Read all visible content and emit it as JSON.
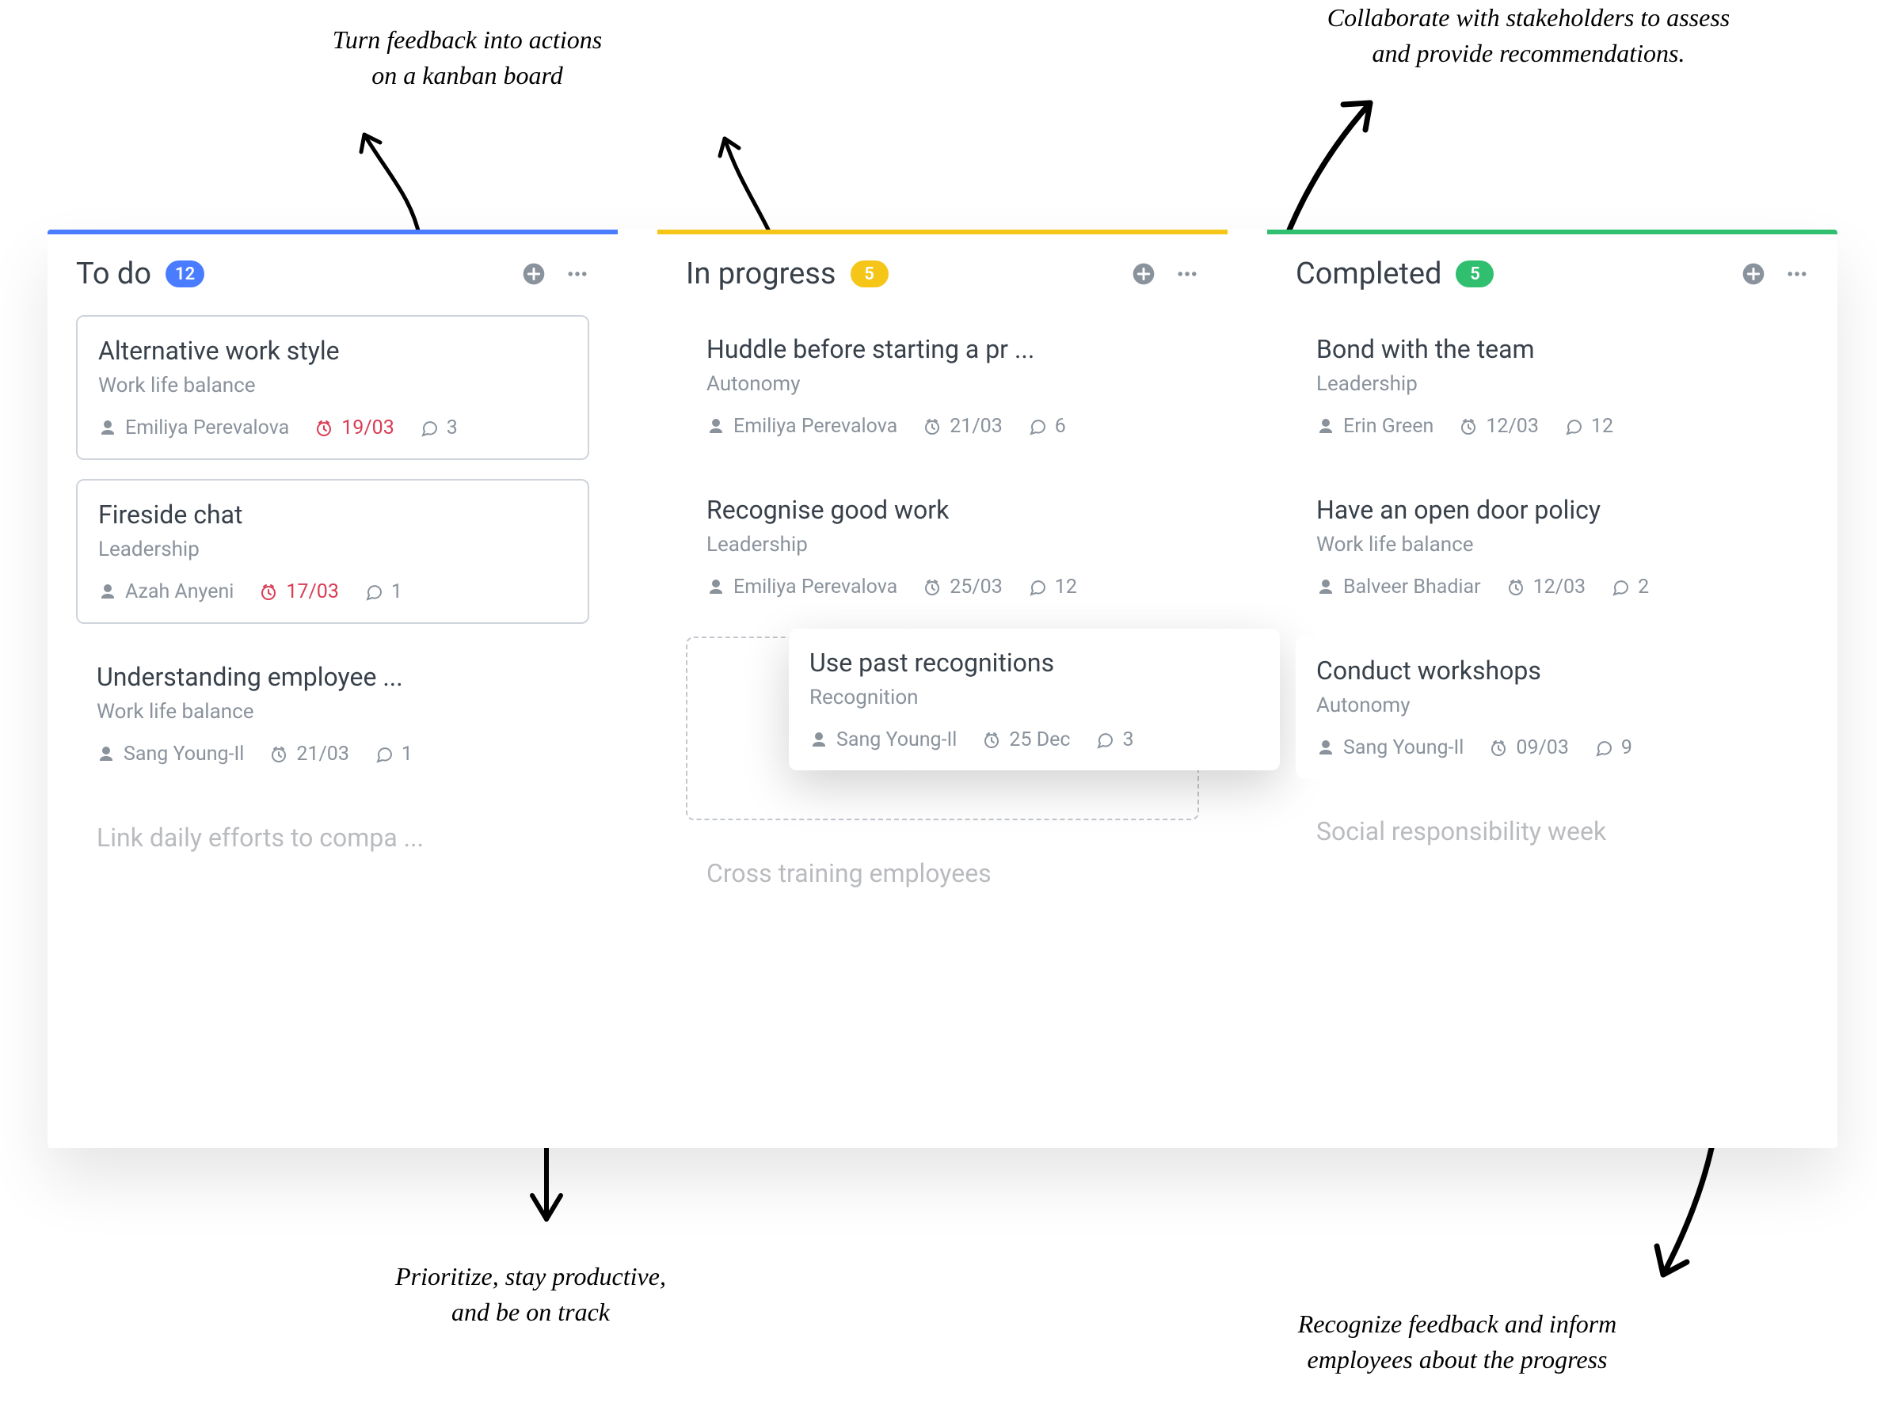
{
  "annotations": {
    "top_left": "Turn feedback into actions\non a kanban board",
    "top_right": "Collaborate with stakeholders to assess\nand provide recommendations.",
    "bottom_left": "Prioritize, stay productive,\nand be on track",
    "bottom_right": "Recognize feedback and inform\nemployees about the progress"
  },
  "columns": [
    {
      "title": "To do",
      "count": "12",
      "color": "blue",
      "cards": [
        {
          "title": "Alternative work style",
          "category": "Work life balance",
          "assignee": "Emiliya Perevalova",
          "due": "19/03",
          "overdue": true,
          "comments": "3",
          "bordered": true
        },
        {
          "title": "Fireside chat",
          "category": "Leadership",
          "assignee": "Azah Anyeni",
          "due": "17/03",
          "overdue": true,
          "comments": "1",
          "bordered": true
        },
        {
          "title": "Understanding employee ...",
          "category": "Work life balance",
          "assignee": "Sang Young-Il",
          "due": "21/03",
          "overdue": false,
          "comments": "1",
          "bordered": false
        }
      ],
      "faded": {
        "title": "Link daily efforts to compa ..."
      }
    },
    {
      "title": "In progress",
      "count": "5",
      "color": "yellow",
      "cards": [
        {
          "title": "Huddle before starting a pr ...",
          "category": "Autonomy",
          "assignee": "Emiliya Perevalova",
          "due": "21/03",
          "overdue": false,
          "comments": "6",
          "bordered": false
        },
        {
          "title": "Recognise good work",
          "category": "Leadership",
          "assignee": "Emiliya Perevalova",
          "due": "25/03",
          "overdue": false,
          "comments": "12",
          "bordered": false
        }
      ],
      "dragging": {
        "title": "Use past recognitions",
        "category": "Recognition",
        "assignee": "Sang Young-Il",
        "due": "25 Dec",
        "comments": "3"
      },
      "faded": {
        "title": "Cross training employees"
      }
    },
    {
      "title": "Completed",
      "count": "5",
      "color": "green",
      "cards": [
        {
          "title": "Bond with the team",
          "category": "Leadership",
          "assignee": "Erin Green",
          "due": "12/03",
          "overdue": false,
          "comments": "12",
          "bordered": false
        },
        {
          "title": "Have an open door policy",
          "category": "Work life balance",
          "assignee": "Balveer Bhadiar",
          "due": "12/03",
          "overdue": false,
          "comments": "2",
          "bordered": false
        },
        {
          "title": "Conduct workshops",
          "category": "Autonomy",
          "assignee": "Sang Young-Il",
          "due": "09/03",
          "overdue": false,
          "comments": "9",
          "bordered": false
        }
      ],
      "faded": {
        "title": "Social responsibility week"
      }
    }
  ]
}
